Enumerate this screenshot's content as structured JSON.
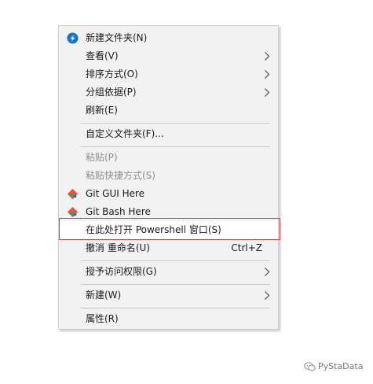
{
  "menu": {
    "items": [
      {
        "label": "新建文件夹(N)",
        "icon": "new-folder-icon"
      },
      {
        "label": "查看(V)",
        "submenu": true
      },
      {
        "label": "排序方式(O)",
        "submenu": true
      },
      {
        "label": "分组依据(P)",
        "submenu": true
      },
      {
        "label": "刷新(E)"
      },
      {
        "label": "自定义文件夹(F)..."
      },
      {
        "label": "粘贴(P)",
        "disabled": true
      },
      {
        "label": "粘贴快捷方式(S)",
        "disabled": true
      },
      {
        "label": "Git GUI Here",
        "icon": "git-icon"
      },
      {
        "label": "Git Bash Here",
        "icon": "git-icon"
      },
      {
        "label": "在此处打开 Powershell 窗口(S)",
        "highlighted": true
      },
      {
        "label": "撤消 重命名(U)",
        "shortcut": "Ctrl+Z"
      },
      {
        "label": "授予访问权限(G)",
        "submenu": true
      },
      {
        "label": "新建(W)",
        "submenu": true
      },
      {
        "label": "属性(R)"
      }
    ]
  },
  "colors": {
    "menu_background": "#f2f2f2",
    "highlight_border": "#d0454c",
    "disabled_text": "#8f8f8f",
    "new_folder_icon": "#1a73c9",
    "git_icon": "#e8543f"
  },
  "watermark": {
    "text": "PyStaData",
    "icon": "wechat-icon"
  }
}
